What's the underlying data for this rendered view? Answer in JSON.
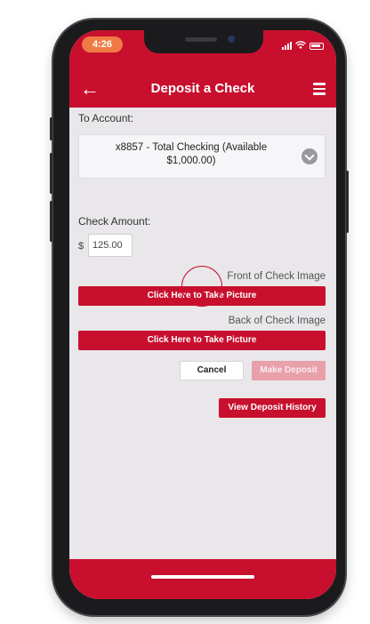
{
  "status_bar": {
    "time": "4:26"
  },
  "navbar": {
    "title": "Deposit a Check",
    "back_glyph": "←"
  },
  "form": {
    "to_account_label": "To Account:",
    "account_line1": "x8857 - Total Checking (Available",
    "account_line2": "$1,000.00)",
    "check_amount_label": "Check Amount:",
    "currency_symbol": "$",
    "amount_value": "125.00",
    "front_label": "Front of Check Image",
    "front_button": "Click Here to Take Picture",
    "back_label": "Back of Check Image",
    "back_button": "Click Here to Take Picture",
    "cancel_button": "Cancel",
    "make_deposit_button": "Make Deposit",
    "view_history_button": "View Deposit History"
  },
  "colors": {
    "brand_red": "#c8102e",
    "disabled_red": "#e8a0ab",
    "time_pill": "#f07a45"
  },
  "icons": {
    "back": "back-arrow-icon",
    "menu": "hamburger-menu-icon",
    "dropdown": "chevron-down-icon",
    "signal": "signal-icon",
    "wifi": "wifi-icon",
    "battery": "battery-icon"
  }
}
